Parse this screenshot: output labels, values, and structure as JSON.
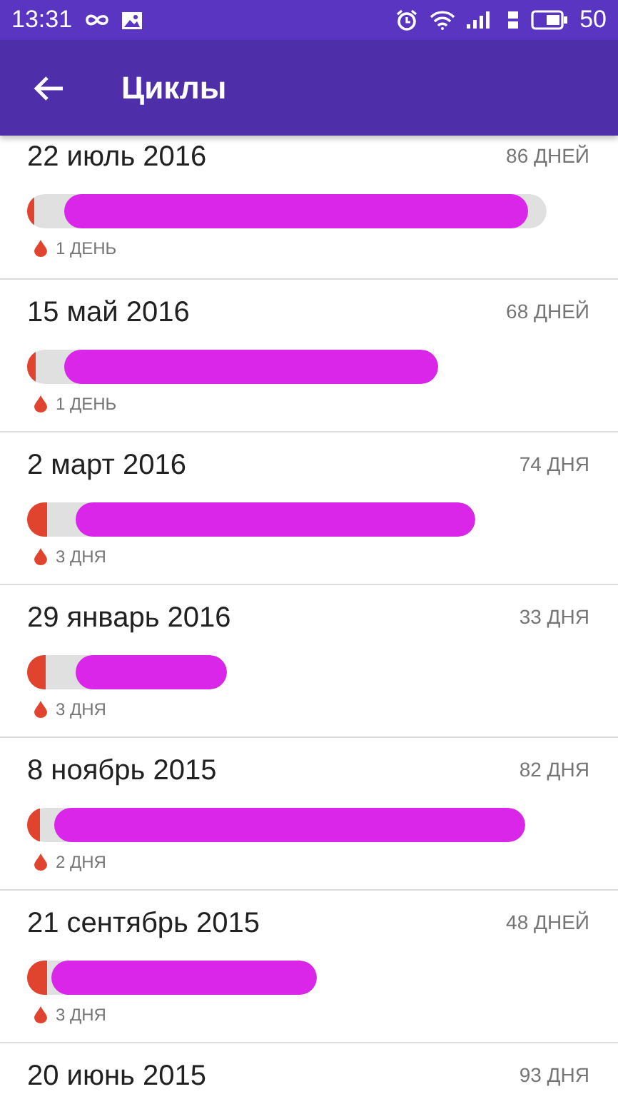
{
  "status_bar": {
    "time": "13:31",
    "battery": "50"
  },
  "toolbar": {
    "title": "Циклы"
  },
  "cycles": [
    {
      "date": "22 июль 2016",
      "length": "86 ДНЕЙ",
      "period": "1 ДЕНЬ"
    },
    {
      "date": "15 май 2016",
      "length": "68 ДНЕЙ",
      "period": "1 ДЕНЬ"
    },
    {
      "date": "2 март 2016",
      "length": "74 ДНЯ",
      "period": "3 ДНЯ"
    },
    {
      "date": "29 январь 2016",
      "length": "33 ДНЯ",
      "period": "3 ДНЯ"
    },
    {
      "date": "8 ноябрь 2015",
      "length": "82 ДНЯ",
      "period": "2 ДНЯ"
    },
    {
      "date": "21 сентябрь 2015",
      "length": "48 ДНЕЙ",
      "period": "3 ДНЯ"
    },
    {
      "date": "20 июнь 2015",
      "length": "93 ДНЯ"
    }
  ]
}
